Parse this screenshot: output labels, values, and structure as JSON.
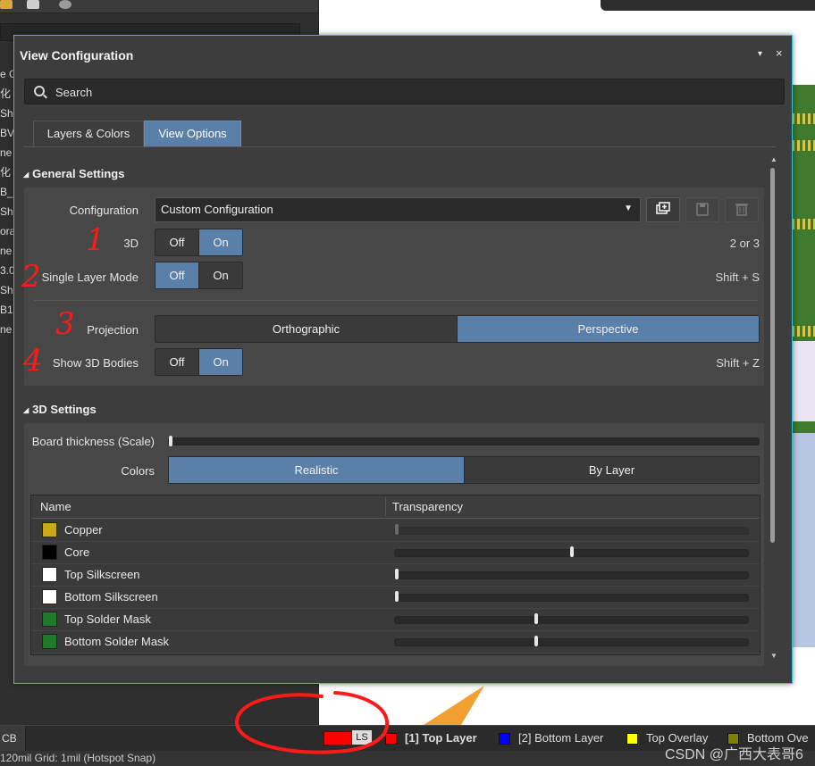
{
  "background": {
    "left_clipped_rows": [
      "e G",
      "化",
      "Sh",
      "BV",
      "ne",
      "化",
      "B_",
      "Sh",
      "ora",
      "ne",
      "3.0",
      "Sh",
      "B1",
      "ne"
    ],
    "status_bar": {
      "pcb_tab": "CB",
      "ls_label": "LS",
      "layers": [
        {
          "label": "[1] Top Layer",
          "color": "#ff0000",
          "active": true
        },
        {
          "label": "[2] Bottom Layer",
          "color": "#0000ff",
          "active": false
        },
        {
          "label": "Top Overlay",
          "color": "#ffff00",
          "active": false
        },
        {
          "label": "Bottom Ove",
          "color": "#808000",
          "active": false
        }
      ],
      "info_text": "120mil    Grid: 1mil      (Hotspot Snap)"
    },
    "watermark": "CSDN @广西大表哥6"
  },
  "dialog": {
    "title": "View Configuration",
    "menu_icon": "▾",
    "close_icon": "×",
    "search": {
      "placeholder": "Search",
      "value": ""
    },
    "tabs": [
      {
        "label": "Layers & Colors",
        "active": false
      },
      {
        "label": "View Options",
        "active": true
      }
    ],
    "general": {
      "title": "General Settings",
      "configuration": {
        "label": "Configuration",
        "value": "Custom Configuration"
      },
      "three_d": {
        "label": "3D",
        "off": "Off",
        "on": "On",
        "selected": "On",
        "shortcut": "2 or 3"
      },
      "single_layer": {
        "label": "Single Layer Mode",
        "off": "Off",
        "on": "On",
        "selected": "Off",
        "shortcut": "Shift + S"
      },
      "projection": {
        "label": "Projection",
        "options": [
          "Orthographic",
          "Perspective"
        ],
        "selected": "Perspective"
      },
      "bodies": {
        "label": "Show 3D Bodies",
        "off": "Off",
        "on": "On",
        "selected": "On",
        "shortcut": "Shift + Z"
      }
    },
    "three_d_settings": {
      "title": "3D Settings",
      "board_thickness": {
        "label": "Board thickness (Scale)",
        "value": 0.0
      },
      "colors": {
        "label": "Colors",
        "options": [
          "Realistic",
          "By Layer"
        ],
        "selected": "Realistic"
      },
      "grid": {
        "columns": [
          "Name",
          "Transparency"
        ],
        "rows": [
          {
            "name": "Copper",
            "color": "#c9a81c",
            "transparency": 0.0,
            "disabled": true
          },
          {
            "name": "Core",
            "color": "#000000",
            "transparency": 0.5,
            "disabled": false
          },
          {
            "name": "Top Silkscreen",
            "color": "#ffffff",
            "transparency": 0.0,
            "disabled": false
          },
          {
            "name": "Bottom Silkscreen",
            "color": "#ffffff",
            "transparency": 0.0,
            "disabled": false
          },
          {
            "name": "Top Solder Mask",
            "color": "#1f7a2a",
            "transparency": 0.4,
            "disabled": false
          },
          {
            "name": "Bottom Solder Mask",
            "color": "#1f7a2a",
            "transparency": 0.4,
            "disabled": false
          }
        ]
      }
    },
    "annotations": [
      "1",
      "2",
      "3",
      "4"
    ]
  }
}
